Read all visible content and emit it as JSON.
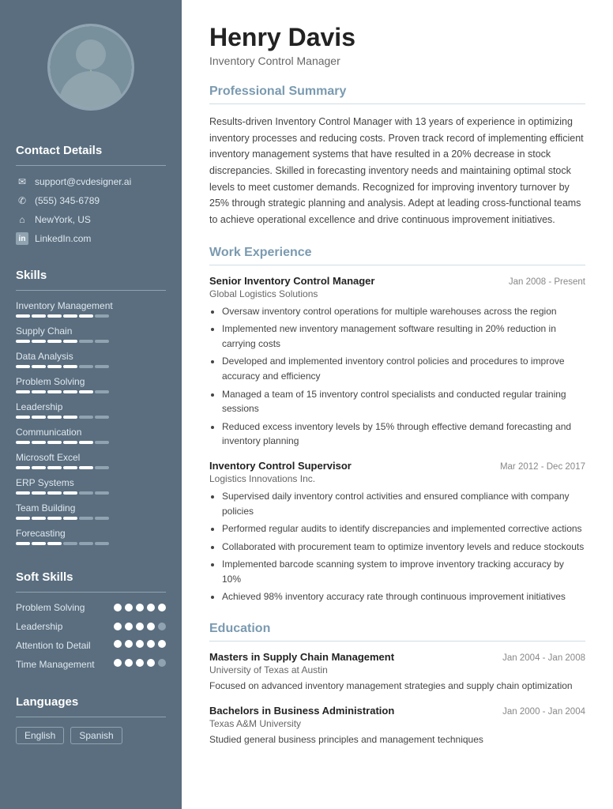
{
  "sidebar": {
    "contact": {
      "title": "Contact Details",
      "items": [
        {
          "icon": "✉",
          "text": "support@cvdesigner.ai",
          "type": "email"
        },
        {
          "icon": "✆",
          "text": "(555) 345-6789",
          "type": "phone"
        },
        {
          "icon": "⌂",
          "text": "NewYork, US",
          "type": "address"
        },
        {
          "icon": "in",
          "text": "LinkedIn.com",
          "type": "linkedin"
        }
      ]
    },
    "skills": {
      "title": "Skills",
      "items": [
        {
          "label": "Inventory Management",
          "filled": 5,
          "total": 6
        },
        {
          "label": "Supply Chain",
          "filled": 4,
          "total": 6
        },
        {
          "label": "Data Analysis",
          "filled": 4,
          "total": 6
        },
        {
          "label": "Problem Solving",
          "filled": 5,
          "total": 6
        },
        {
          "label": "Leadership",
          "filled": 4,
          "total": 6
        },
        {
          "label": "Communication",
          "filled": 5,
          "total": 6
        },
        {
          "label": "Microsoft Excel",
          "filled": 5,
          "total": 6
        },
        {
          "label": "ERP Systems",
          "filled": 4,
          "total": 6
        },
        {
          "label": "Team Building",
          "filled": 4,
          "total": 6
        },
        {
          "label": "Forecasting",
          "filled": 3,
          "total": 6
        }
      ]
    },
    "soft_skills": {
      "title": "Soft Skills",
      "items": [
        {
          "label": "Problem Solving",
          "filled": 5,
          "total": 5
        },
        {
          "label": "Leadership",
          "filled": 4,
          "total": 5
        },
        {
          "label": "Attention to Detail",
          "filled": 5,
          "total": 5
        },
        {
          "label": "Time Management",
          "filled": 4,
          "total": 5
        }
      ]
    },
    "languages": {
      "title": "Languages",
      "items": [
        "English",
        "Spanish"
      ]
    }
  },
  "main": {
    "name": "Henry Davis",
    "title": "Inventory Control Manager",
    "summary": {
      "section_title": "Professional Summary",
      "text": "Results-driven Inventory Control Manager with 13 years of experience in optimizing inventory processes and reducing costs. Proven track record of implementing efficient inventory management systems that have resulted in a 20% decrease in stock discrepancies. Skilled in forecasting inventory needs and maintaining optimal stock levels to meet customer demands. Recognized for improving inventory turnover by 25% through strategic planning and analysis. Adept at leading cross-functional teams to achieve operational excellence and drive continuous improvement initiatives."
    },
    "experience": {
      "section_title": "Work Experience",
      "jobs": [
        {
          "title": "Senior Inventory Control Manager",
          "company": "Global Logistics Solutions",
          "dates": "Jan 2008 - Present",
          "bullets": [
            "Oversaw inventory control operations for multiple warehouses across the region",
            "Implemented new inventory management software resulting in 20% reduction in carrying costs",
            "Developed and implemented inventory control policies and procedures to improve accuracy and efficiency",
            "Managed a team of 15 inventory control specialists and conducted regular training sessions",
            "Reduced excess inventory levels by 15% through effective demand forecasting and inventory planning"
          ]
        },
        {
          "title": "Inventory Control Supervisor",
          "company": "Logistics Innovations Inc.",
          "dates": "Mar 2012 - Dec 2017",
          "bullets": [
            "Supervised daily inventory control activities and ensured compliance with company policies",
            "Performed regular audits to identify discrepancies and implemented corrective actions",
            "Collaborated with procurement team to optimize inventory levels and reduce stockouts",
            "Implemented barcode scanning system to improve inventory tracking accuracy by 10%",
            "Achieved 98% inventory accuracy rate through continuous improvement initiatives"
          ]
        }
      ]
    },
    "education": {
      "section_title": "Education",
      "items": [
        {
          "degree": "Masters in Supply Chain Management",
          "school": "University of Texas at Austin",
          "dates": "Jan 2004 - Jan 2008",
          "desc": "Focused on advanced inventory management strategies and supply chain optimization"
        },
        {
          "degree": "Bachelors in Business Administration",
          "school": "Texas A&M University",
          "dates": "Jan 2000 - Jan 2004",
          "desc": "Studied general business principles and management techniques"
        }
      ]
    }
  }
}
